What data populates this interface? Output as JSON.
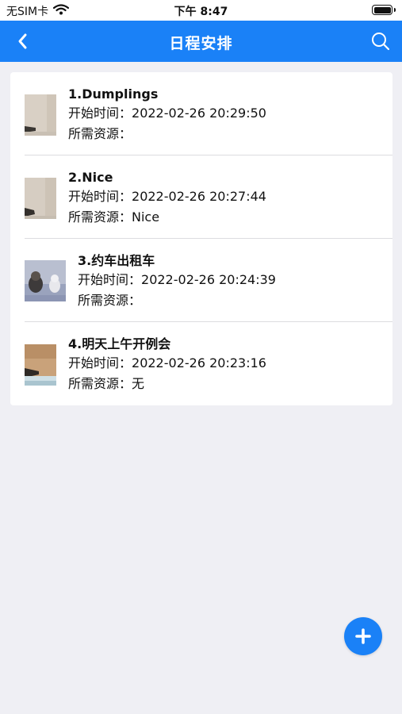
{
  "status": {
    "carrier": "无SIM卡",
    "time": "下午 8:47"
  },
  "nav": {
    "title": "日程安排"
  },
  "labels": {
    "start_time": "开始时间：",
    "resources": "所需资源："
  },
  "items": [
    {
      "title": "1.Dumplings",
      "start_time": "2022-02-26 20:29:50",
      "resources": ""
    },
    {
      "title": "2.Nice",
      "start_time": "2022-02-26 20:27:44",
      "resources": "Nice"
    },
    {
      "title": "3.约车出租车",
      "start_time": "2022-02-26 20:24:39",
      "resources": ""
    },
    {
      "title": "4.明天上午开例会",
      "start_time": "2022-02-26 20:23:16",
      "resources": "无"
    }
  ],
  "colors": {
    "accent": "#1a81f7",
    "background": "#efeff4"
  },
  "icons": {
    "back": "chevron-left-icon",
    "search": "search-icon",
    "add": "plus-icon",
    "wifi": "wifi-icon",
    "battery": "battery-icon"
  }
}
